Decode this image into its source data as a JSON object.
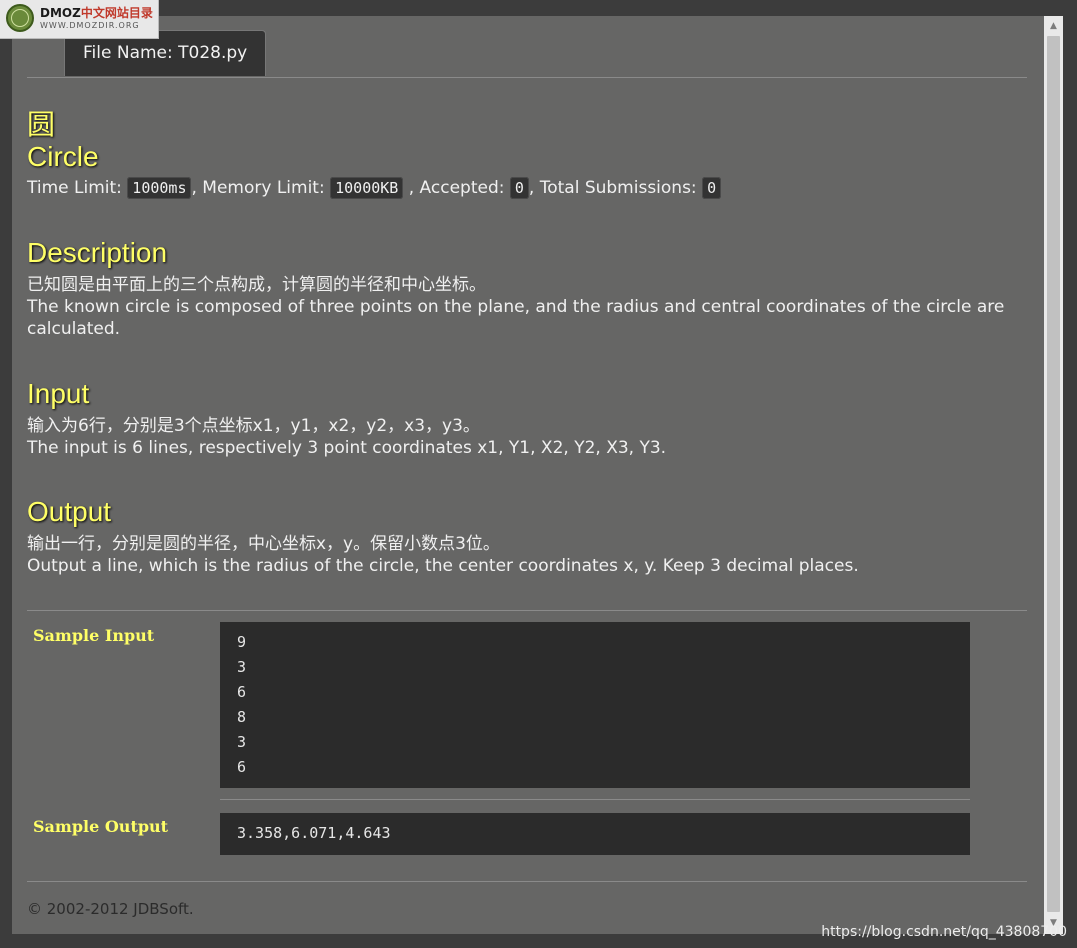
{
  "logo": {
    "name": "DMOZ",
    "name_cn": "中文网站目录",
    "url": "WWW.DMOZDIR.ORG"
  },
  "tab": {
    "label": "File Name:  T028.py"
  },
  "problem": {
    "title_cn": "圆",
    "title_en": "Circle",
    "time_limit_label": "Time Limit: ",
    "time_limit": "1000ms",
    "memory_limit_label": ", Memory Limit: ",
    "memory_limit": "10000KB",
    "accepted_label": " , Accepted: ",
    "accepted": "0",
    "total_label": ", Total Submissions: ",
    "total": "0"
  },
  "description": {
    "heading": "Description",
    "cn": "已知圆是由平面上的三个点构成，计算圆的半径和中心坐标。",
    "en": "The known circle is composed of three points on the plane, and the radius and central coordinates of the circle are calculated."
  },
  "input": {
    "heading": "Input",
    "cn": "输入为6行，分别是3个点坐标x1，y1，x2，y2，x3，y3。",
    "en": "The input is 6 lines, respectively 3 point coordinates x1, Y1, X2, Y2, X3, Y3."
  },
  "output": {
    "heading": "Output",
    "cn": "输出一行，分别是圆的半径，中心坐标x，y。保留小数点3位。",
    "en": "Output a line, which is the radius of the circle, the center coordinates x, y. Keep 3 decimal places."
  },
  "sample_input": {
    "label": "Sample Input",
    "lines": [
      "9",
      "3",
      "6",
      "8",
      "3",
      "6"
    ]
  },
  "sample_output": {
    "label": "Sample Output",
    "text": "3.358,6.071,4.643"
  },
  "footer": {
    "text": "© 2002-2012  JDBSoft."
  },
  "watermark": {
    "text": "https://blog.csdn.net/qq_43808700"
  },
  "colors": {
    "heading": "#ffff66",
    "background": "#666665",
    "code_bg": "#2b2b2b"
  }
}
